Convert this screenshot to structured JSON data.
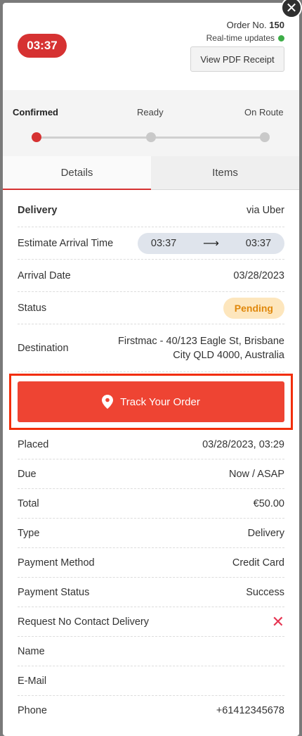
{
  "header": {
    "timer": "03:37",
    "order_label": "Order No.",
    "order_number": "150",
    "realtime_label": "Real-time updates",
    "pdf_button": "View PDF Receipt"
  },
  "close_button": "✕",
  "progress": {
    "steps": [
      "Confirmed",
      "Ready",
      "On Route"
    ],
    "current_step": "Confirmed"
  },
  "tabs": [
    {
      "label": "Details",
      "active": true
    },
    {
      "label": "Items",
      "active": false
    }
  ],
  "details": {
    "delivery": {
      "label": "Delivery",
      "value": "via Uber"
    },
    "eta": {
      "label": "Estimate Arrival Time",
      "from": "03:37",
      "to": "03:37"
    },
    "arrival_date": {
      "label": "Arrival Date",
      "value": "03/28/2023"
    },
    "status": {
      "label": "Status",
      "value": "Pending"
    },
    "destination": {
      "label": "Destination",
      "line1": "Firstmac - 40/123 Eagle St, Brisbane",
      "line2": "City QLD 4000, Australia"
    },
    "track_button": "Track Your Order",
    "placed": {
      "label": "Placed",
      "value": "03/28/2023, 03:29"
    },
    "due": {
      "label": "Due",
      "value": "Now / ASAP"
    },
    "total": {
      "label": "Total",
      "value": "€50.00"
    },
    "type": {
      "label": "Type",
      "value": "Delivery"
    },
    "payment_method": {
      "label": "Payment Method",
      "value": "Credit Card"
    },
    "payment_status": {
      "label": "Payment Status",
      "value": "Success"
    },
    "no_contact": {
      "label": "Request No Contact Delivery",
      "value": "✕"
    },
    "name": {
      "label": "Name",
      "value": ""
    },
    "email": {
      "label": "E-Mail",
      "value": ""
    },
    "phone": {
      "label": "Phone",
      "value": "+61412345678"
    }
  },
  "colors": {
    "accent": "#d63232",
    "track_button": "#ee4433",
    "highlight_border": "#f22e0a",
    "pending_bg": "#fde6bd",
    "pending_text": "#e0880c",
    "success": "#3aa64a",
    "realtime_dot": "#3dad47"
  },
  "icons": {
    "close": "close-icon",
    "track": "map-pin-icon",
    "eta_arrow": "arrow-right-icon",
    "no_contact": "x-mark-icon",
    "realtime": "status-dot-icon"
  }
}
